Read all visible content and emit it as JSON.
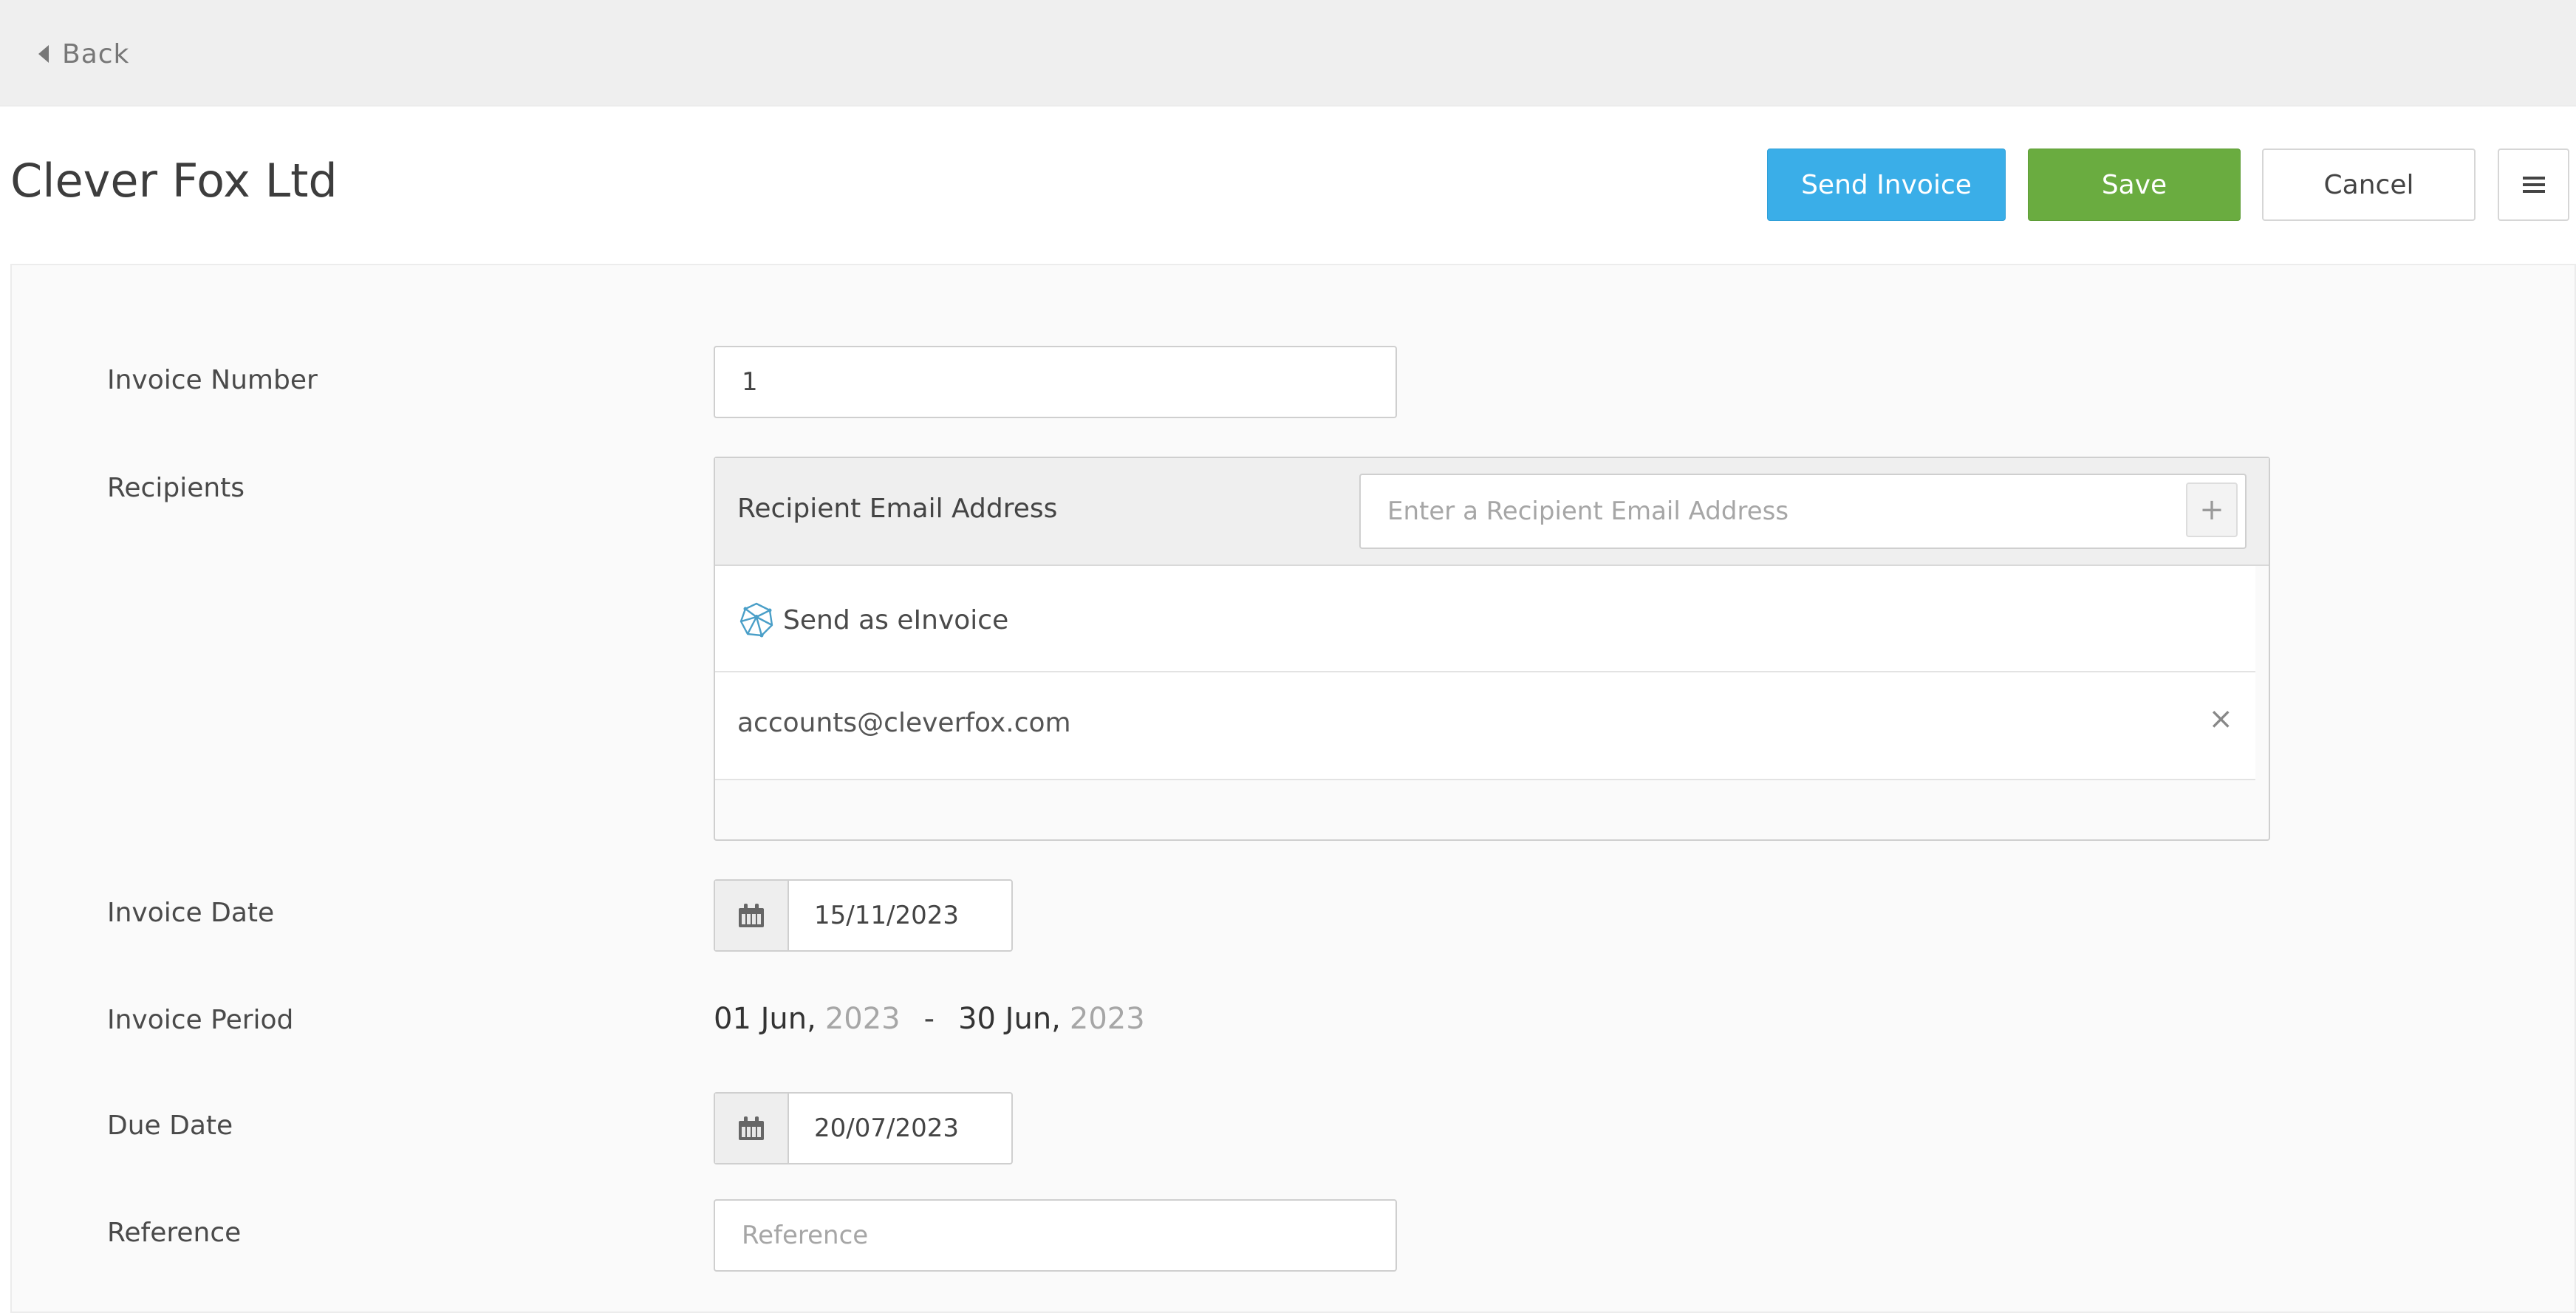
{
  "nav": {
    "back_label": "Back"
  },
  "header": {
    "title": "Clever Fox Ltd",
    "send_invoice_label": "Send Invoice",
    "save_label": "Save",
    "cancel_label": "Cancel"
  },
  "form": {
    "invoice_number": {
      "label": "Invoice Number",
      "value": "1"
    },
    "recipients": {
      "label": "Recipients",
      "header_label": "Recipient Email Address",
      "email_placeholder": "Enter a Recipient Email Address",
      "add_symbol": "+",
      "einvoice_label": "Send as eInvoice",
      "emails": [
        "accounts@cleverfox.com"
      ],
      "remove_symbol": "×"
    },
    "invoice_date": {
      "label": "Invoice Date",
      "value": "15/11/2023"
    },
    "invoice_period": {
      "label": "Invoice Period",
      "start_day_month": "01 Jun,",
      "start_year": "2023",
      "separator": "-",
      "end_day_month": "30 Jun,",
      "end_year": "2023"
    },
    "due_date": {
      "label": "Due Date",
      "value": "20/07/2023"
    },
    "reference": {
      "label": "Reference",
      "value": "",
      "placeholder": "Reference"
    }
  },
  "colors": {
    "send_button": "#3aaee8",
    "save_button": "#6aac40",
    "topbar": "#efefef"
  },
  "icons": {
    "back": "caret-left-icon",
    "menu": "hamburger-menu-icon",
    "einvoice": "einvoice-network-icon",
    "calendar": "calendar-icon"
  }
}
